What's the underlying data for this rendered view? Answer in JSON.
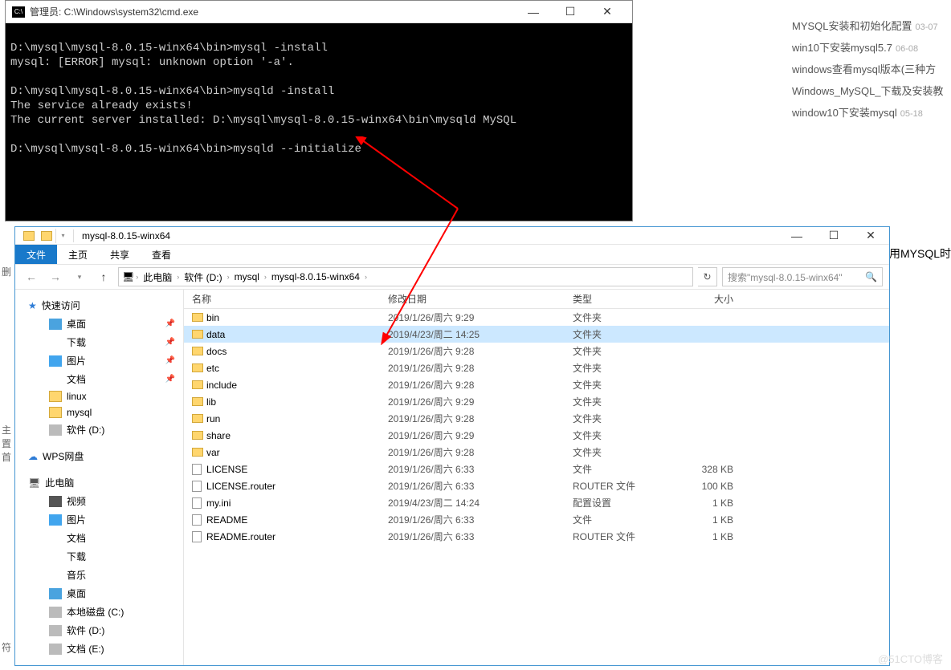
{
  "cmd": {
    "title": "管理员: C:\\Windows\\system32\\cmd.exe",
    "lines": "\nD:\\mysql\\mysql-8.0.15-winx64\\bin>mysql -install\nmysql: [ERROR] mysql: unknown option '-a'.\n\nD:\\mysql\\mysql-8.0.15-winx64\\bin>mysqld -install\nThe service already exists!\nThe current server installed: D:\\mysql\\mysql-8.0.15-winx64\\bin\\mysqld MySQL\n\nD:\\mysql\\mysql-8.0.15-winx64\\bin>mysqld --initialize"
  },
  "rightLinks": [
    {
      "t": "MYSQL安装和初始化配置",
      "d": "03-07"
    },
    {
      "t": "win10下安装mysql5.7",
      "d": "06-08"
    },
    {
      "t": "windows查看mysql版本(三种方",
      "d": ""
    },
    {
      "t": "Windows_MySQL_下载及安装教",
      "d": ""
    },
    {
      "t": "window10下安装mysql",
      "d": "05-18"
    }
  ],
  "rightText": "用MYSQL时",
  "explorer": {
    "title": "mysql-8.0.15-winx64",
    "ribbon": {
      "file": "文件",
      "home": "主页",
      "share": "共享",
      "view": "查看"
    },
    "breadcrumb": [
      "此电脑",
      "软件 (D:)",
      "mysql",
      "mysql-8.0.15-winx64"
    ],
    "searchPlaceholder": "搜索\"mysql-8.0.15-winx64\"",
    "cols": {
      "name": "名称",
      "date": "修改日期",
      "type": "类型",
      "size": "大小"
    },
    "side": {
      "quick": "快速访问",
      "quickItems": [
        "桌面",
        "下载",
        "图片",
        "文档",
        "linux",
        "mysql",
        "软件 (D:)"
      ],
      "wps": "WPS网盘",
      "pc": "此电脑",
      "pcItems": [
        "视频",
        "图片",
        "文档",
        "下载",
        "音乐",
        "桌面",
        "本地磁盘 (C:)",
        "软件 (D:)",
        "文档 (E:)"
      ]
    },
    "files": [
      {
        "n": "bin",
        "d": "2019/1/26/周六 9:29",
        "t": "文件夹",
        "s": "",
        "f": true
      },
      {
        "n": "data",
        "d": "2019/4/23/周二 14:25",
        "t": "文件夹",
        "s": "",
        "f": true,
        "sel": true
      },
      {
        "n": "docs",
        "d": "2019/1/26/周六 9:28",
        "t": "文件夹",
        "s": "",
        "f": true
      },
      {
        "n": "etc",
        "d": "2019/1/26/周六 9:28",
        "t": "文件夹",
        "s": "",
        "f": true
      },
      {
        "n": "include",
        "d": "2019/1/26/周六 9:28",
        "t": "文件夹",
        "s": "",
        "f": true
      },
      {
        "n": "lib",
        "d": "2019/1/26/周六 9:29",
        "t": "文件夹",
        "s": "",
        "f": true
      },
      {
        "n": "run",
        "d": "2019/1/26/周六 9:28",
        "t": "文件夹",
        "s": "",
        "f": true
      },
      {
        "n": "share",
        "d": "2019/1/26/周六 9:29",
        "t": "文件夹",
        "s": "",
        "f": true
      },
      {
        "n": "var",
        "d": "2019/1/26/周六 9:28",
        "t": "文件夹",
        "s": "",
        "f": true
      },
      {
        "n": "LICENSE",
        "d": "2019/1/26/周六 6:33",
        "t": "文件",
        "s": "328 KB",
        "f": false
      },
      {
        "n": "LICENSE.router",
        "d": "2019/1/26/周六 6:33",
        "t": "ROUTER 文件",
        "s": "100 KB",
        "f": false
      },
      {
        "n": "my.ini",
        "d": "2019/4/23/周二 14:24",
        "t": "配置设置",
        "s": "1 KB",
        "f": false
      },
      {
        "n": "README",
        "d": "2019/1/26/周六 6:33",
        "t": "文件",
        "s": "1 KB",
        "f": false
      },
      {
        "n": "README.router",
        "d": "2019/1/26/周六 6:33",
        "t": "ROUTER 文件",
        "s": "1 KB",
        "f": false
      }
    ]
  },
  "watermark": "@51CTO博客"
}
